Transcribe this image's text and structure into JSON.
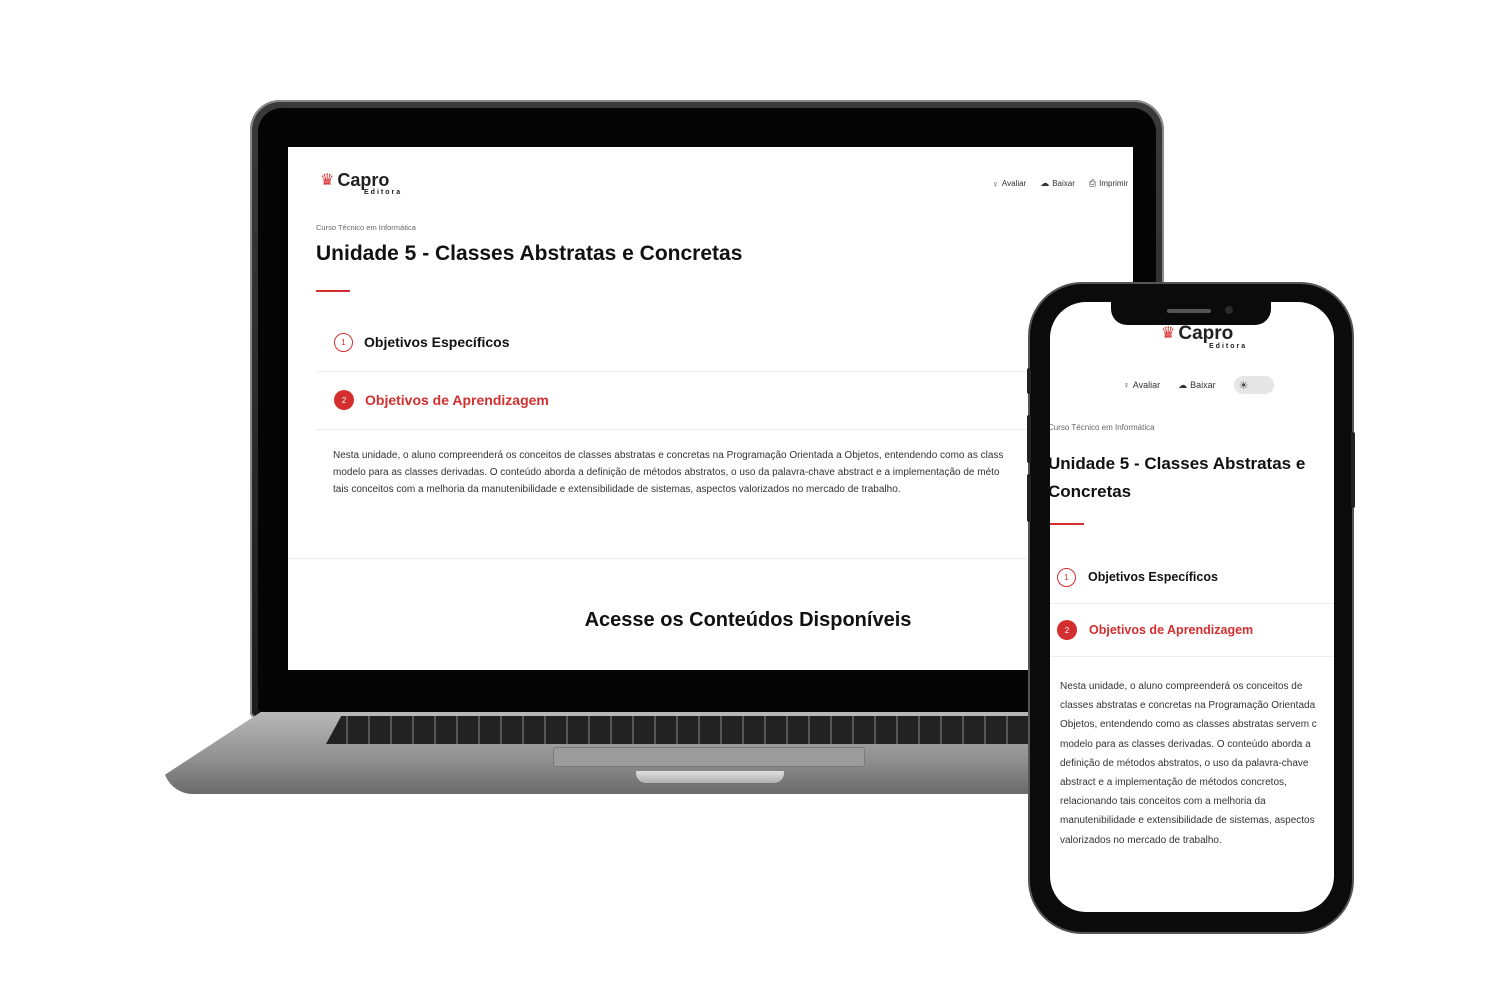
{
  "brand": {
    "name": "Capro",
    "sub": "Editora"
  },
  "actions": {
    "rate": "Avaliar",
    "download": "Baixar",
    "print": "Imprimir"
  },
  "breadcrumb": "Curso Técnico em Informática",
  "title": "Unidade 5 - Classes Abstratas e Concretas",
  "phone_title": {
    "line1": "Unidade 5 - Classes Abstratas e",
    "line2": "Concretas"
  },
  "accordion": [
    {
      "number": "1",
      "label": "Objetivos Específicos",
      "expanded": false
    },
    {
      "number": "2",
      "label": "Objetivos de Aprendizagem",
      "expanded": true
    }
  ],
  "laptop_body_lines": [
    "Nesta unidade, o aluno compreenderá os conceitos de classes abstratas e concretas na Programação Orientada a Objetos, entendendo como as class",
    "modelo para as classes derivadas. O conteúdo aborda a definição de métodos abstratos, o uso da palavra-chave abstract e a implementação de méto",
    "tais conceitos com a melhoria da manutenibilidade e extensibilidade de sistemas, aspectos valorizados no mercado de trabalho."
  ],
  "phone_body_lines": [
    "Nesta unidade, o aluno compreenderá os conceitos de",
    "classes abstratas e concretas na Programação Orientada",
    "Objetos, entendendo como as classes abstratas servem c",
    "modelo para as classes derivadas. O conteúdo aborda a",
    "definição de métodos abstratos, o uso da palavra-chave",
    "abstract e a implementação de métodos concretos,",
    "relacionando tais conceitos com a melhoria da",
    "manutenibilidade e extensibilidade de sistemas, aspectos",
    "valorizados no mercado de trabalho."
  ],
  "section_heading": "Acesse os Conteúdos Disponíveis",
  "icons": {
    "crown": "crown-icon",
    "rate": "lightbulb-icon",
    "download": "cloud-download-icon",
    "print": "printer-icon",
    "theme": "sun-icon"
  },
  "colors": {
    "accent": "#d32f2f",
    "text": "#111111"
  }
}
